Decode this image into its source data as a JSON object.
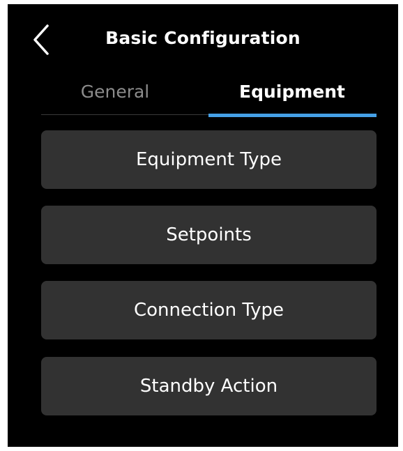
{
  "header": {
    "title": "Basic Configuration",
    "back_icon": "chevron-left-icon"
  },
  "tabs": [
    {
      "label": "General",
      "active": false
    },
    {
      "label": "Equipment",
      "active": true
    }
  ],
  "menu": {
    "items": [
      {
        "label": "Equipment Type"
      },
      {
        "label": "Setpoints"
      },
      {
        "label": "Connection Type"
      },
      {
        "label": "Standby Action"
      }
    ]
  },
  "colors": {
    "background": "#000000",
    "button": "#323232",
    "accent": "#45a0e6",
    "inactive_tab": "#8c8c8c"
  }
}
